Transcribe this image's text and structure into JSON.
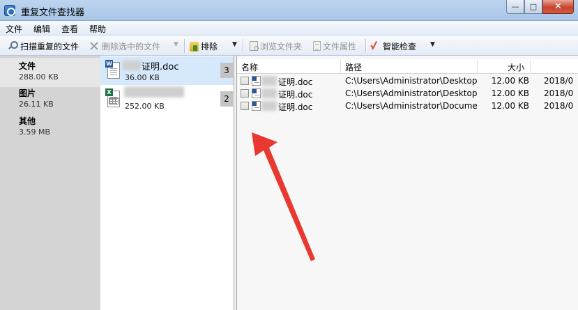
{
  "window": {
    "title": "重复文件查找器",
    "min_symbol": "—",
    "max_symbol": "□",
    "close_symbol": "✕"
  },
  "menu": [
    "文件",
    "编辑",
    "查看",
    "帮助"
  ],
  "toolbar": {
    "scan_label": "扫描重复的文件",
    "delete_label": "删除选中的文件",
    "exclude_label": "排除",
    "browse_label": "浏览文件夹",
    "properties_label": "文件属性",
    "smart_check_label": "智能检查",
    "dropdown_arrow": "▼"
  },
  "categories": [
    {
      "name": "文件",
      "size": "288.00 KB"
    },
    {
      "name": "图片",
      "size": "26.11 KB"
    },
    {
      "name": "其他",
      "size": "3.59 MB"
    }
  ],
  "groups": [
    {
      "name": "证明.doc",
      "size": "36.00 KB",
      "count": "3",
      "type_icon": "word-doc-icon",
      "badge": "W"
    },
    {
      "name": "",
      "size": "252.00 KB",
      "count": "2",
      "type_icon": "excel-sheet-icon",
      "badge": "X"
    }
  ],
  "table": {
    "columns": [
      "名称",
      "路径",
      "大小",
      ""
    ],
    "rows": [
      {
        "name": "证明.doc",
        "path": "C:\\Users\\Administrator\\Desktop...",
        "size": "12.00 KB",
        "date": "2018/0"
      },
      {
        "name": "证明.doc",
        "path": "C:\\Users\\Administrator\\Desktop",
        "size": "12.00 KB",
        "date": "2018/0"
      },
      {
        "name": "证明.doc",
        "path": "C:\\Users\\Administrator\\Docume...",
        "size": "12.00 KB",
        "date": "2018/0"
      }
    ]
  },
  "colors": {
    "annotation_arrow": "#e8382f",
    "selected_group": "#d6e8fb",
    "category_panel": "#d4d4d4"
  }
}
